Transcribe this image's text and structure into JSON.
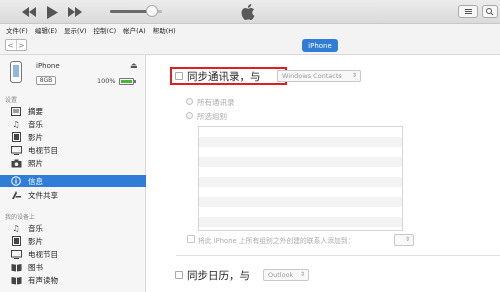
{
  "app": {
    "accent": "#2f7dd6"
  },
  "player": {
    "controls": [
      "rewind-icon",
      "play-icon",
      "fast-forward-icon"
    ],
    "volume_level": 0.8
  },
  "menu": [
    "文件(F)",
    "编辑(E)",
    "显示(V)",
    "控制(C)",
    "帐户(A)",
    "帮助(H)"
  ],
  "nav": {
    "back": "<",
    "forward": ">",
    "device_pill": "iPhone"
  },
  "device": {
    "name": "iPhone",
    "capacity": "8GB",
    "battery": "100%",
    "battery_level": 1.0
  },
  "sidebar": {
    "settings_title": "设置",
    "settings_items": [
      {
        "label": "摘要",
        "icon": "summary-icon"
      },
      {
        "label": "音乐",
        "icon": "music-icon"
      },
      {
        "label": "影片",
        "icon": "film-icon"
      },
      {
        "label": "电视节目",
        "icon": "tv-icon"
      },
      {
        "label": "照片",
        "icon": "camera-icon"
      },
      {
        "label": "信息",
        "icon": "info-icon",
        "selected": true
      },
      {
        "label": "文件共享",
        "icon": "apps-icon"
      }
    ],
    "on_device_title": "我的设备上",
    "on_device_items": [
      {
        "label": "音乐",
        "icon": "music-icon"
      },
      {
        "label": "影片",
        "icon": "film-icon"
      },
      {
        "label": "电视节目",
        "icon": "tv-icon"
      },
      {
        "label": "图书",
        "icon": "book-icon"
      },
      {
        "label": "有声读物",
        "icon": "audiobook-icon"
      }
    ]
  },
  "contacts": {
    "sync_label": "同步通讯录，与",
    "source_select": "Windows Contacts",
    "all_contacts": "所有通讯录",
    "selected_groups": "所选组别",
    "add_to_group": "将此 iPhone 上所有组别之外创建的联系人添加到："
  },
  "calendar": {
    "sync_label": "同步日历，与",
    "source_select": "Outlook"
  }
}
